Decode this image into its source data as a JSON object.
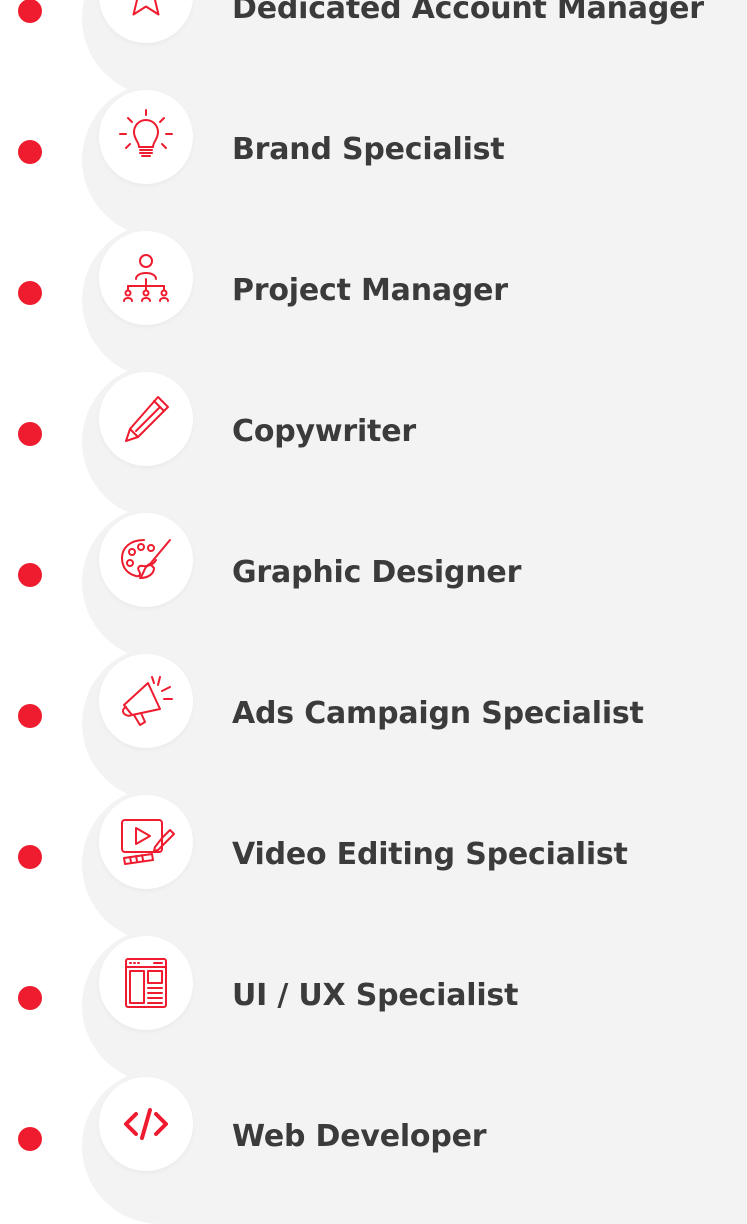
{
  "accent_color": "#ee1c2e",
  "text_color": "#3b3b3b",
  "card_color": "#f3f3f3",
  "items": [
    {
      "label": "Dedicated Account Manager",
      "icon": "star-icon"
    },
    {
      "label": "Brand Specialist",
      "icon": "lightbulb-icon"
    },
    {
      "label": "Project Manager",
      "icon": "team-hierarchy-icon"
    },
    {
      "label": "Copywriter",
      "icon": "pencil-icon"
    },
    {
      "label": "Graphic Designer",
      "icon": "palette-brush-icon"
    },
    {
      "label": "Ads Campaign Specialist",
      "icon": "megaphone-icon"
    },
    {
      "label": "Video Editing Specialist",
      "icon": "video-edit-icon"
    },
    {
      "label": "UI / UX Specialist",
      "icon": "layout-icon"
    },
    {
      "label": "Web Developer",
      "icon": "code-icon"
    }
  ]
}
